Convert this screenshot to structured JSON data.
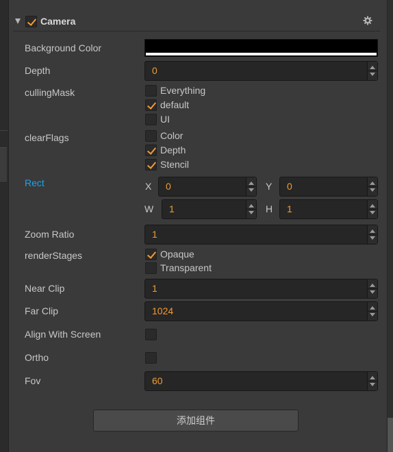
{
  "component": {
    "title": "Camera",
    "enabled": true,
    "collapse_icon": "triangle-down-icon",
    "settings_icon": "gear-icon"
  },
  "properties": {
    "background_color": {
      "label": "Background Color",
      "value": "#000000"
    },
    "depth": {
      "label": "Depth",
      "value": "0"
    },
    "culling_mask": {
      "label": "cullingMask",
      "options": [
        {
          "label": "Everything",
          "checked": false
        },
        {
          "label": "default",
          "checked": true
        },
        {
          "label": "UI",
          "checked": false
        }
      ]
    },
    "clear_flags": {
      "label": "clearFlags",
      "options": [
        {
          "label": "Color",
          "checked": false
        },
        {
          "label": "Depth",
          "checked": true
        },
        {
          "label": "Stencil",
          "checked": true
        }
      ]
    },
    "rect": {
      "label": "Rect",
      "x_label": "X",
      "x": "0",
      "y_label": "Y",
      "y": "0",
      "w_label": "W",
      "w": "1",
      "h_label": "H",
      "h": "1"
    },
    "zoom_ratio": {
      "label": "Zoom Ratio",
      "value": "1"
    },
    "render_stages": {
      "label": "renderStages",
      "options": [
        {
          "label": "Opaque",
          "checked": true
        },
        {
          "label": "Transparent",
          "checked": false
        }
      ]
    },
    "near_clip": {
      "label": "Near Clip",
      "value": "1"
    },
    "far_clip": {
      "label": "Far Clip",
      "value": "1024"
    },
    "align_with_screen": {
      "label": "Align With Screen",
      "checked": false
    },
    "ortho": {
      "label": "Ortho",
      "checked": false
    },
    "fov": {
      "label": "Fov",
      "value": "60"
    }
  },
  "add_component_button": "添加组件",
  "colors": {
    "panel_bg": "#3a3a3a",
    "field_bg": "#262626",
    "accent": "#f29b34",
    "link": "#1ba3ea",
    "text": "#c8c8c8"
  }
}
